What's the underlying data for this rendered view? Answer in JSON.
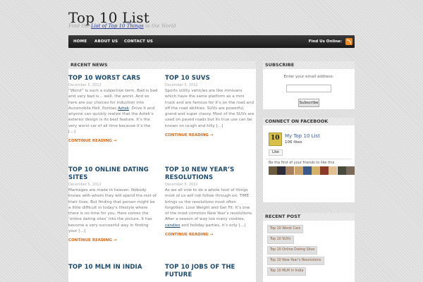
{
  "site": {
    "title": "Top 10 List",
    "tagline_prefix": "Find the ",
    "tagline_link": "List of Top 10 Things",
    "tagline_suffix": " in the World"
  },
  "nav": {
    "items": [
      {
        "label": "HOME"
      },
      {
        "label": "ABOUT US"
      },
      {
        "label": "CONTACT US"
      }
    ],
    "find_us_label": "Find Us Online:",
    "rss_icon": "rss-icon"
  },
  "main": {
    "section_title": "RECENT NEWS",
    "read_more_label": "CONTINUE READING →",
    "posts": [
      {
        "title": "TOP 10 WORST CARS",
        "date": "December 5, 2012",
        "excerpt_before": "“Worst” is such a subjective term. Bad is bad and very bad is… well, the worst. And so here are our choices for induction into Automobile Hell. Pontiac ",
        "excerpt_link": "Aztek",
        "excerpt_after": ": Drive it and anyone can quickly realize that the Aztek’s exterior design is its best feature. It’s the very worst car of all time because it’s the […]"
      },
      {
        "title": "TOP 10 SUVS",
        "date": "December 5, 2012",
        "excerpt": "Sports utility vehicles are like minivans which have the same platform as a mini truck and are famous for it’s on the road and off the road abilities. SUVs are powerful, grand and super classy. Most of the SUVs are used on paved roads but its true use can be known on rough and hilly […]"
      },
      {
        "title": "TOP 10 ONLINE DATING SITES",
        "date": "December 5, 2012",
        "excerpt": "Marriages are made in heaven. Nobody knows with whom they will spend the rest of their lives. But finding that person might be a little difficult in today’s lifestyle where there is no time for you. Here comes the ‘online dating sites’ into the picture. It has become a very successful way in finding your […]"
      },
      {
        "title": "TOP 10 NEW YEAR’S RESOLUTIONS",
        "date": "December 5, 2012",
        "excerpt_before": "As we all vow to do a whole host of things most of us will not follow through on, TIME brings us the resolutions most often forgotten. Lose Weight and Get Fit: It’s one of the most common New Year’s resolutions. After a season of way too many cookies, ",
        "excerpt_link": "candies",
        "excerpt_after": " and holiday parties, it’s only […]"
      },
      {
        "title": "TOP 10 MLM IN INDIA",
        "date": "",
        "excerpt": ""
      },
      {
        "title": "TOP 10 JOBS OF THE FUTURE",
        "date": "",
        "excerpt": ""
      }
    ]
  },
  "sidebar": {
    "subscribe": {
      "title": "SUBSCRIBE",
      "email_label": "Enter your email address:",
      "email_value": "",
      "button_label": "Subscribe"
    },
    "facebook": {
      "title": "CONNECT ON FACEBOOK",
      "page_name": "My Top 10 List",
      "likes": "106 likes",
      "like_button": "Like",
      "friends_text": "Be the first of your friends to like this",
      "friend_colors": [
        "#6b5b3a",
        "#2d2d3a",
        "#a87f5c",
        "#caa36b",
        "#3a5a8a",
        "#d4b26a",
        "#8a3a2a",
        "#e0c090",
        "#4a4a3a",
        "#7a6a5a"
      ]
    },
    "recent_post": {
      "title": "RECENT POST",
      "items": [
        "Top 10 Worst Cars",
        "Top 10 SUVs",
        "Top 10 Online Dating Sites",
        "Top 10 New Year’s Resolutions",
        "Top 10 MLM in India"
      ]
    }
  }
}
